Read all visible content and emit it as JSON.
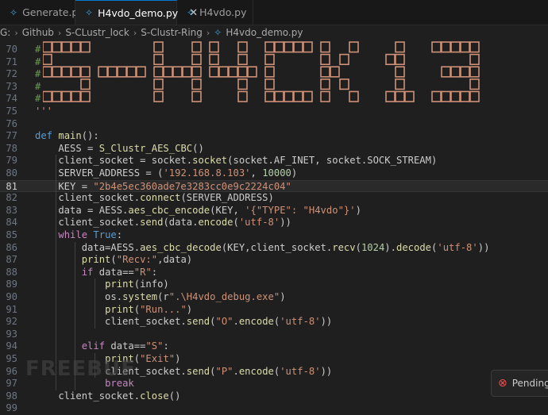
{
  "tabs": [
    {
      "label": "Generate.py",
      "active": false
    },
    {
      "label": "H4vdo_demo.py",
      "active": true
    },
    {
      "label": "H4vdo.py",
      "active": false
    }
  ],
  "breadcrumbs": [
    "G:",
    "Github",
    "S-CLustr_lock",
    "S-Clustr-Ring",
    "H4vdo_demo.py"
  ],
  "editor": {
    "current_line": "81",
    "lines": [
      {
        "num": "70",
        "text": "#"
      },
      {
        "num": "71",
        "text": "#"
      },
      {
        "num": "72",
        "text": "#"
      },
      {
        "num": "73",
        "text": "#"
      },
      {
        "num": "74",
        "text": "#"
      },
      {
        "num": "75",
        "text": "'''"
      },
      {
        "num": "76",
        "text": ""
      },
      {
        "num": "77",
        "text": "def main():"
      },
      {
        "num": "78",
        "text": "    AESS = S_Clustr_AES_CBC()"
      },
      {
        "num": "79",
        "text": "    client_socket = socket.socket(socket.AF_INET, socket.SOCK_STREAM)"
      },
      {
        "num": "80",
        "text": "    SERVER_ADDRESS = ('192.168.8.103', 10000)"
      },
      {
        "num": "81",
        "text": "    KEY = \"2b4e5ec360ade7e3283cc0e9c2224c04\""
      },
      {
        "num": "82",
        "text": "    client_socket.connect(SERVER_ADDRESS)"
      },
      {
        "num": "83",
        "text": "    data = AESS.aes_cbc_encode(KEY, '{\"TYPE\": \"H4vdo\"}')"
      },
      {
        "num": "84",
        "text": "    client_socket.send(data.encode('utf-8'))"
      },
      {
        "num": "85",
        "text": "    while True:"
      },
      {
        "num": "86",
        "text": "        data=AESS.aes_cbc_decode(KEY,client_socket.recv(1024).decode('utf-8'))"
      },
      {
        "num": "87",
        "text": "        print(\"Recv:\",data)"
      },
      {
        "num": "88",
        "text": "        if data==\"R\":"
      },
      {
        "num": "89",
        "text": "            print(info)"
      },
      {
        "num": "90",
        "text": "            os.system(r\".\\H4vdo_debug.exe\")"
      },
      {
        "num": "91",
        "text": "            print(\"Run...\")"
      },
      {
        "num": "92",
        "text": "            client_socket.send(\"O\".encode('utf-8'))"
      },
      {
        "num": "93",
        "text": ""
      },
      {
        "num": "94",
        "text": "        elif data==\"S\":"
      },
      {
        "num": "95",
        "text": "            print(\"Exit\")"
      },
      {
        "num": "96",
        "text": "            client_socket.send(\"P\".encode('utf-8'))"
      },
      {
        "num": "97",
        "text": "            break"
      },
      {
        "num": "98",
        "text": "    client_socket.close()"
      },
      {
        "num": "99",
        "text": ""
      }
    ]
  },
  "ascii_banner": {
    "text": "S-H4CK13",
    "color": "#ce9178"
  },
  "watermark": "FREEBUF",
  "notification": {
    "text": "Pending re"
  },
  "colors": {
    "keyword": "#569cd6",
    "control": "#c586c0",
    "function": "#dcdcaa",
    "string": "#ce9178",
    "number": "#b5cea8",
    "comment": "#6a9955"
  }
}
